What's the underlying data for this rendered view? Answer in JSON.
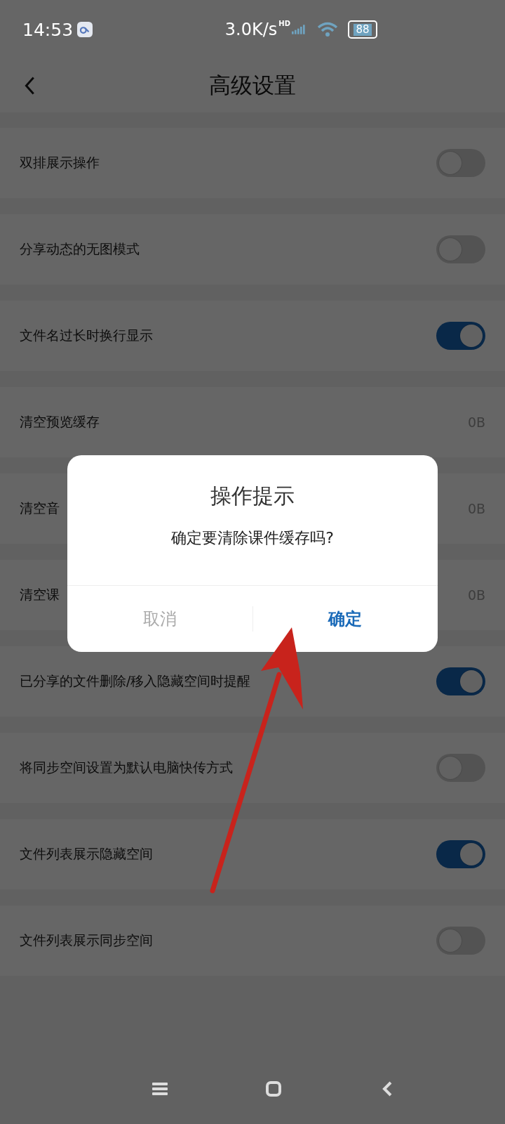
{
  "status_bar": {
    "time": "14:53",
    "speed": "3.0K/s",
    "signal_badge": "HD",
    "battery": "88"
  },
  "header": {
    "title": "高级设置"
  },
  "settings": [
    {
      "label": "双排展示操作",
      "kind": "toggle",
      "on": false
    },
    {
      "label": "分享动态的无图模式",
      "kind": "toggle",
      "on": false
    },
    {
      "label": "文件名过长时换行显示",
      "kind": "toggle",
      "on": true
    },
    {
      "label": "清空预览缓存",
      "kind": "value",
      "value": "0B"
    },
    {
      "label": "清空音",
      "kind": "value",
      "value": "0B"
    },
    {
      "label": "清空课",
      "kind": "value",
      "value": "0B"
    },
    {
      "label": "已分享的文件删除/移入隐藏空间时提醒",
      "kind": "toggle",
      "on": true
    },
    {
      "label": "将同步空间设置为默认电脑快传方式",
      "kind": "toggle",
      "on": false
    },
    {
      "label": "文件列表展示隐藏空间",
      "kind": "toggle",
      "on": true
    },
    {
      "label": "文件列表展示同步空间",
      "kind": "toggle",
      "on": false
    }
  ],
  "dialog": {
    "title": "操作提示",
    "message": "确定要清除课件缓存吗?",
    "buttons": [
      {
        "label": "取消",
        "kind": "cancel"
      },
      {
        "label": "确定",
        "kind": "confirm"
      }
    ]
  }
}
